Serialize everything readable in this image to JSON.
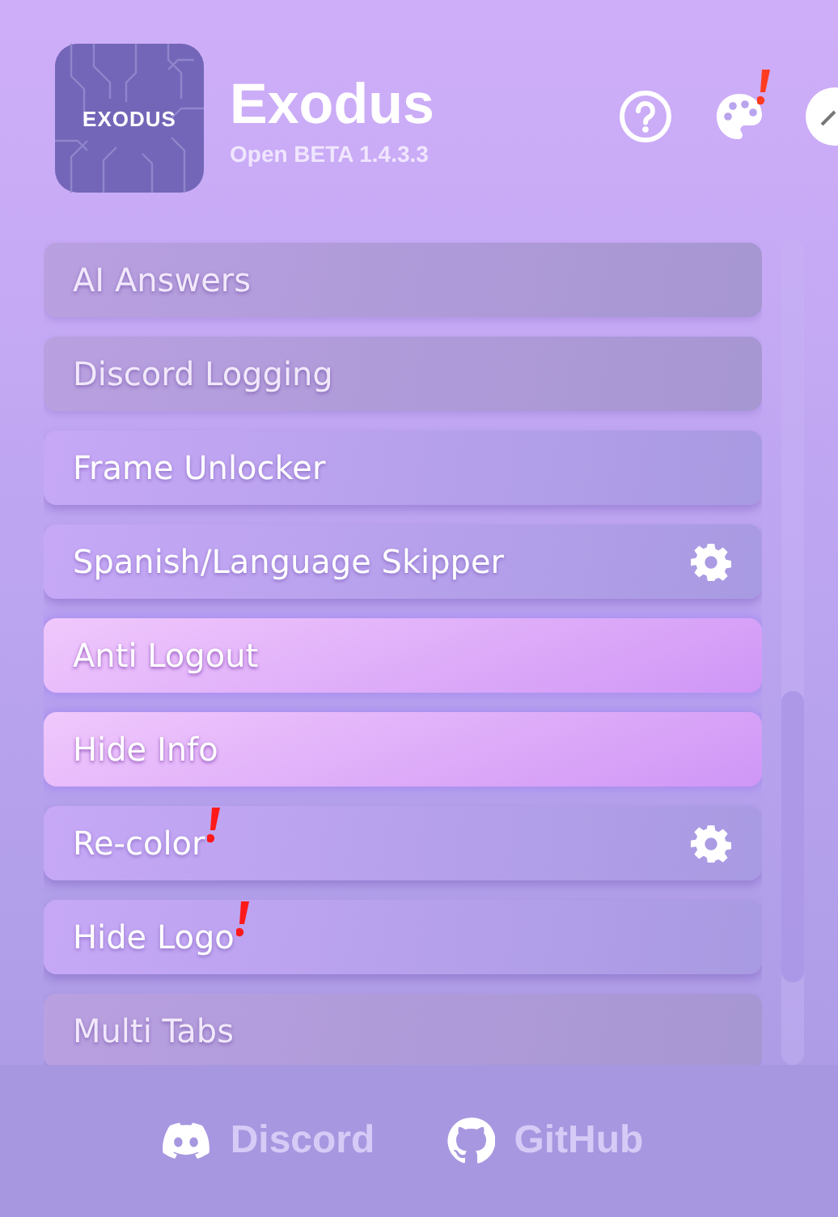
{
  "app": {
    "logo_text": "EXODUS",
    "title": "Exodus",
    "subtitle": "Open BETA 1.4.3.3",
    "palette_alert": true
  },
  "modules": [
    {
      "name": "AI Answers",
      "disabled": true,
      "on": false,
      "settings": false,
      "alert": false
    },
    {
      "name": "Discord Logging",
      "disabled": true,
      "on": false,
      "settings": false,
      "alert": false
    },
    {
      "name": "Frame Unlocker",
      "disabled": false,
      "on": false,
      "settings": false,
      "alert": false
    },
    {
      "name": "Spanish/Language Skipper",
      "disabled": false,
      "on": false,
      "settings": true,
      "alert": false
    },
    {
      "name": "Anti Logout",
      "disabled": false,
      "on": true,
      "settings": false,
      "alert": false
    },
    {
      "name": "Hide Info",
      "disabled": false,
      "on": true,
      "settings": false,
      "alert": false
    },
    {
      "name": "Re-color",
      "disabled": false,
      "on": false,
      "settings": true,
      "alert": true
    },
    {
      "name": "Hide Logo",
      "disabled": false,
      "on": false,
      "settings": false,
      "alert": true
    },
    {
      "name": "Multi Tabs",
      "disabled": true,
      "on": false,
      "settings": false,
      "alert": false
    }
  ],
  "footer": {
    "links": [
      {
        "kind": "discord",
        "label": "Discord"
      },
      {
        "kind": "github",
        "label": "GitHub"
      }
    ]
  }
}
